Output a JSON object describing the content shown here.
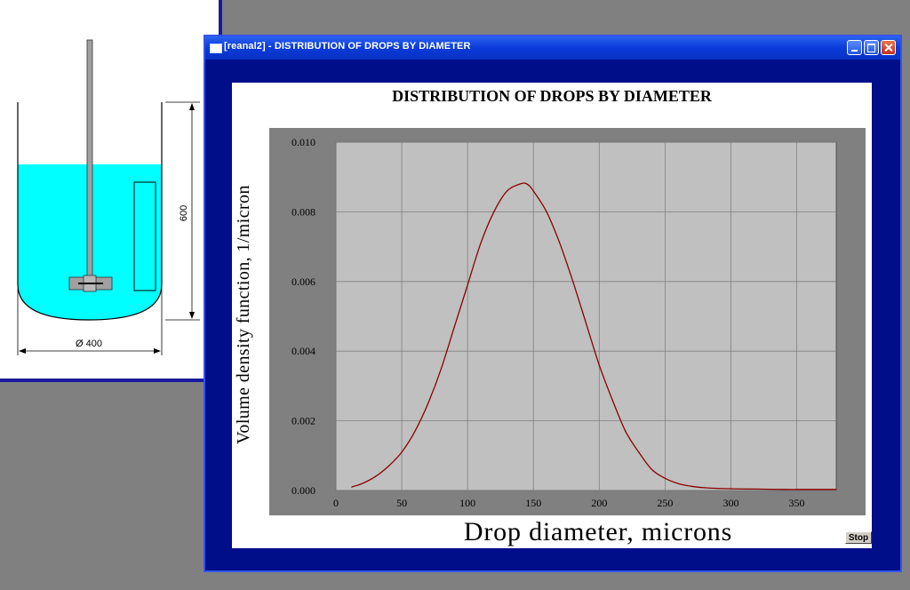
{
  "window": {
    "title": "[reanal2] - DISTRIBUTION OF DROPS BY DIAMETER"
  },
  "reactor": {
    "height_label": "600",
    "diameter_label": "Ø 400",
    "liquid_color": "#00ffff"
  },
  "stop_button": {
    "label": "Stop"
  },
  "chart_data": {
    "type": "line",
    "title": "DISTRIBUTION OF DROPS BY DIAMETER",
    "xlabel": "Drop diameter, microns",
    "ylabel": "Volume density function, 1/micron",
    "xlim": [
      0,
      380
    ],
    "ylim": [
      0,
      0.01
    ],
    "xticks": [
      0,
      50,
      100,
      150,
      200,
      250,
      300,
      350
    ],
    "yticks": [
      "0.000",
      "0.002",
      "0.004",
      "0.006",
      "0.008",
      "0.010"
    ],
    "grid": true,
    "line_color": "#8b0000",
    "plot_bg": "#c0c0c0",
    "frame_bg": "#808080",
    "series": [
      {
        "x": [
          12,
          20,
          30,
          40,
          50,
          60,
          70,
          80,
          90,
          100,
          110,
          120,
          130,
          140,
          145,
          150,
          160,
          170,
          180,
          190,
          200,
          210,
          220,
          230,
          240,
          250,
          260,
          270,
          280,
          290,
          300,
          320,
          340,
          360,
          380
        ],
        "y": [
          0.0001,
          0.0002,
          0.0004,
          0.0007,
          0.0011,
          0.0017,
          0.0025,
          0.0035,
          0.0047,
          0.0059,
          0.0071,
          0.008,
          0.0086,
          0.0088,
          0.0088,
          0.0086,
          0.008,
          0.0071,
          0.006,
          0.0048,
          0.0036,
          0.0026,
          0.0017,
          0.0011,
          0.0006,
          0.00035,
          0.0002,
          0.00012,
          8e-05,
          6e-05,
          5e-05,
          4e-05,
          3e-05,
          3e-05,
          3e-05
        ]
      }
    ]
  }
}
